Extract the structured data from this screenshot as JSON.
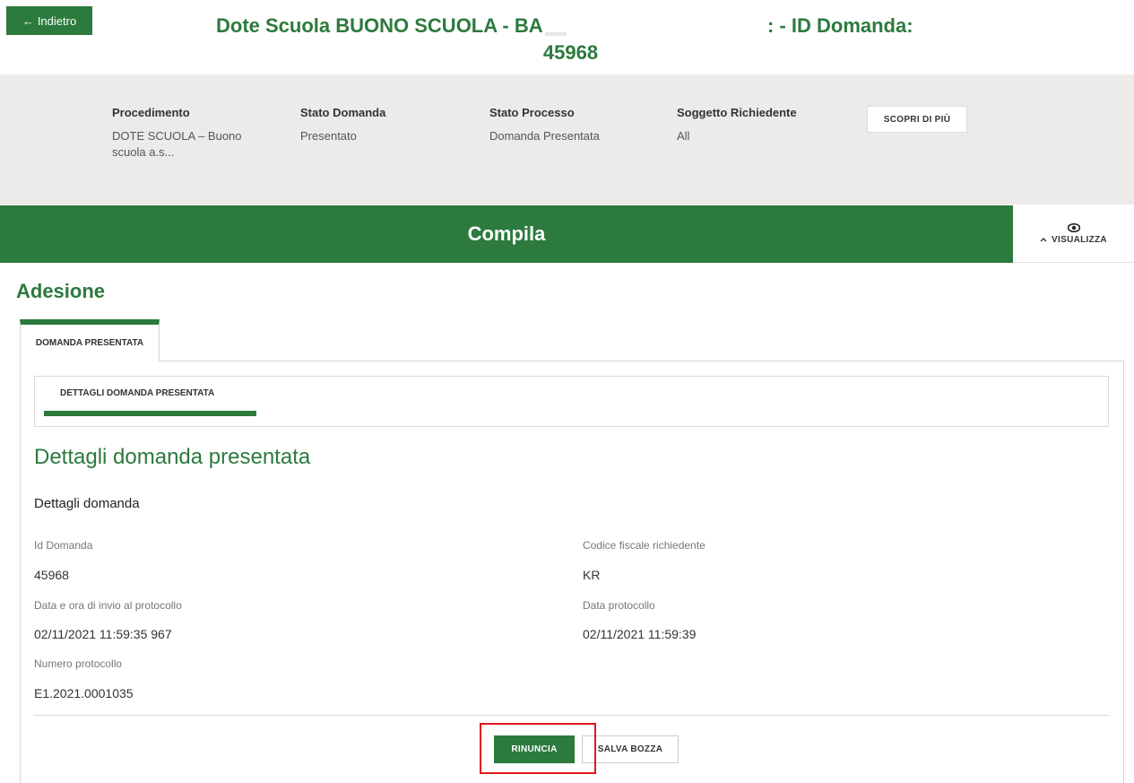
{
  "header": {
    "back_label": "Indietro",
    "back_arrow": "←",
    "title_left": "Dote Scuola BUONO SCUOLA - BA",
    "title_right": ": - ID Domanda:",
    "title_id": "45968"
  },
  "info": {
    "procedimento_label": "Procedimento",
    "procedimento_value": "DOTE SCUOLA – Buono scuola a.s...",
    "stato_domanda_label": "Stato Domanda",
    "stato_domanda_value": "Presentato",
    "stato_processo_label": "Stato Processo",
    "stato_processo_value": "Domanda Presentata",
    "soggetto_label": "Soggetto Richiedente",
    "soggetto_value": "All",
    "scopri_label": "SCOPRI DI PIÙ"
  },
  "compila": {
    "title": "Compila",
    "visualizza_label": "VISUALIZZA",
    "visualizza_chevron": "^",
    "eye_glyph": "👁"
  },
  "section": {
    "title": "Adesione",
    "tab_label": "DOMANDA PRESENTATA",
    "subtab_label": "DETTAGLI DOMANDA PRESENTATA"
  },
  "details": {
    "title": "Dettagli domanda presentata",
    "subtitle": "Dettagli domanda",
    "fields": {
      "id_domanda_label": "Id Domanda",
      "id_domanda_value": "45968",
      "codice_fiscale_label": "Codice fiscale richiedente",
      "codice_fiscale_value": "KR",
      "data_invio_label": "Data e ora di invio al protocollo",
      "data_invio_value": "02/11/2021 11:59:35 967",
      "data_protocollo_label": "Data protocollo",
      "data_protocollo_value": "02/11/2021 11:59:39",
      "numero_protocollo_label": "Numero protocollo",
      "numero_protocollo_value": "E1.2021.0001035"
    }
  },
  "actions": {
    "rinuncia_label": "RINUNCIA",
    "salva_bozza_label": "SALVA BOZZA"
  },
  "colors": {
    "brand_green": "#2c7a3d",
    "highlight_red": "#e0161e",
    "band_grey": "#ecebe9"
  }
}
